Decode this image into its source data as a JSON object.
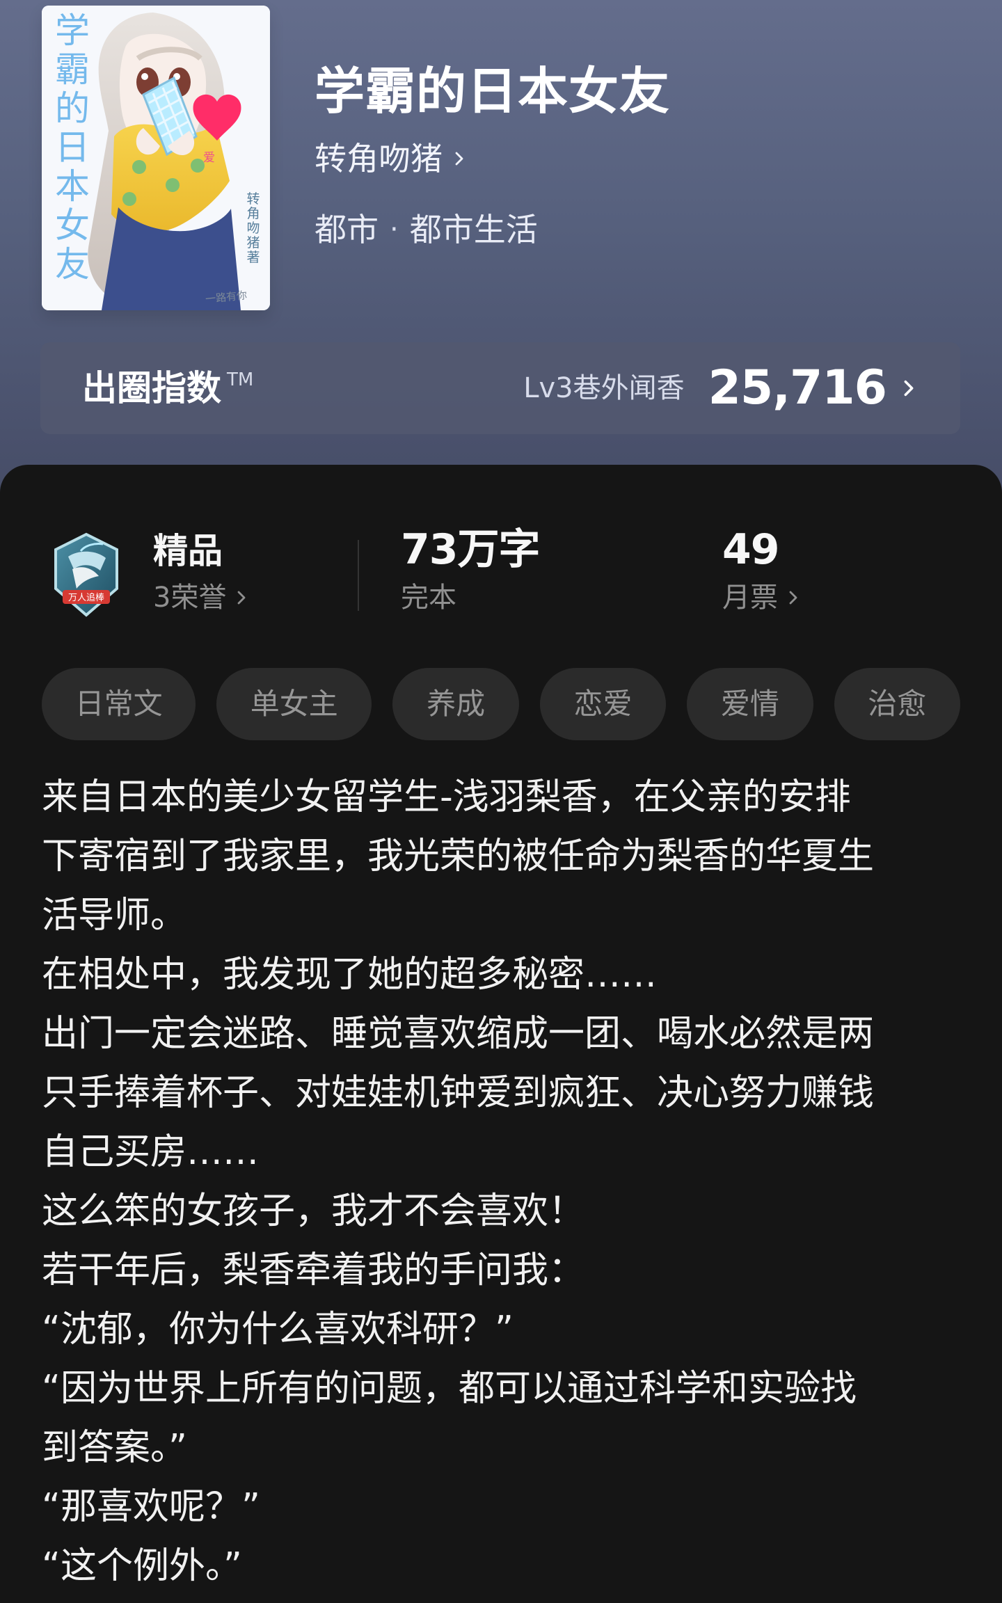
{
  "book": {
    "title": "学霸的日本女友",
    "author": "转角吻猪",
    "category": "都市",
    "subcategory": "都市生活"
  },
  "cover": {
    "title": "学霸的日本女友",
    "author": "转角吻猪",
    "author_suffix": "著",
    "brand": "一路有你"
  },
  "index_card": {
    "title": "出圈指数",
    "tm": "TM",
    "level": "Lv3巷外闻香",
    "score": "25,716"
  },
  "stats": {
    "award": {
      "title": "精品",
      "subtitle": "3荣誉",
      "badge_text": "万人追棒",
      "badge_icon": "premium-badge-icon"
    },
    "words": {
      "value": "73万字",
      "label": "完本"
    },
    "monthly_tickets": {
      "value": "49",
      "label": "月票"
    }
  },
  "tags": [
    "日常文",
    "单女主",
    "养成",
    "恋爱",
    "爱情",
    "治愈"
  ],
  "synopsis": [
    "来自日本的美少女留学生-浅羽梨香，在父亲的安排\n下寄宿到了我家里，我光荣的被任命为梨香的华夏生\n活导师。",
    "在相处中，我发现了她的超多秘密……",
    "出门一定会迷路、睡觉喜欢缩成一团、喝水必然是两\n只手捧着杯子、对娃娃机钟爱到疯狂、决心努力赚钱\n自己买房……",
    "这么笨的女孩子，我才不会喜欢！",
    "若干年后，梨香牵着我的手问我：",
    "“沈郁，你为什么喜欢科研？”",
    "“因为世界上所有的问题，都可以通过科学和实验找\n到答案。”",
    "“那喜欢呢？”",
    "“这个例外。”"
  ],
  "colors": {
    "header_top": "#646d8c",
    "header_bottom": "#3e4358",
    "index_card": "#535970",
    "panel_bg": "#151515",
    "chip_bg": "#2b2b2b",
    "text_primary": "#f1f1f1",
    "text_secondary": "#909090"
  },
  "icons": {
    "chevron": "chevron-right-icon",
    "cover_heart": "heart-icon"
  }
}
